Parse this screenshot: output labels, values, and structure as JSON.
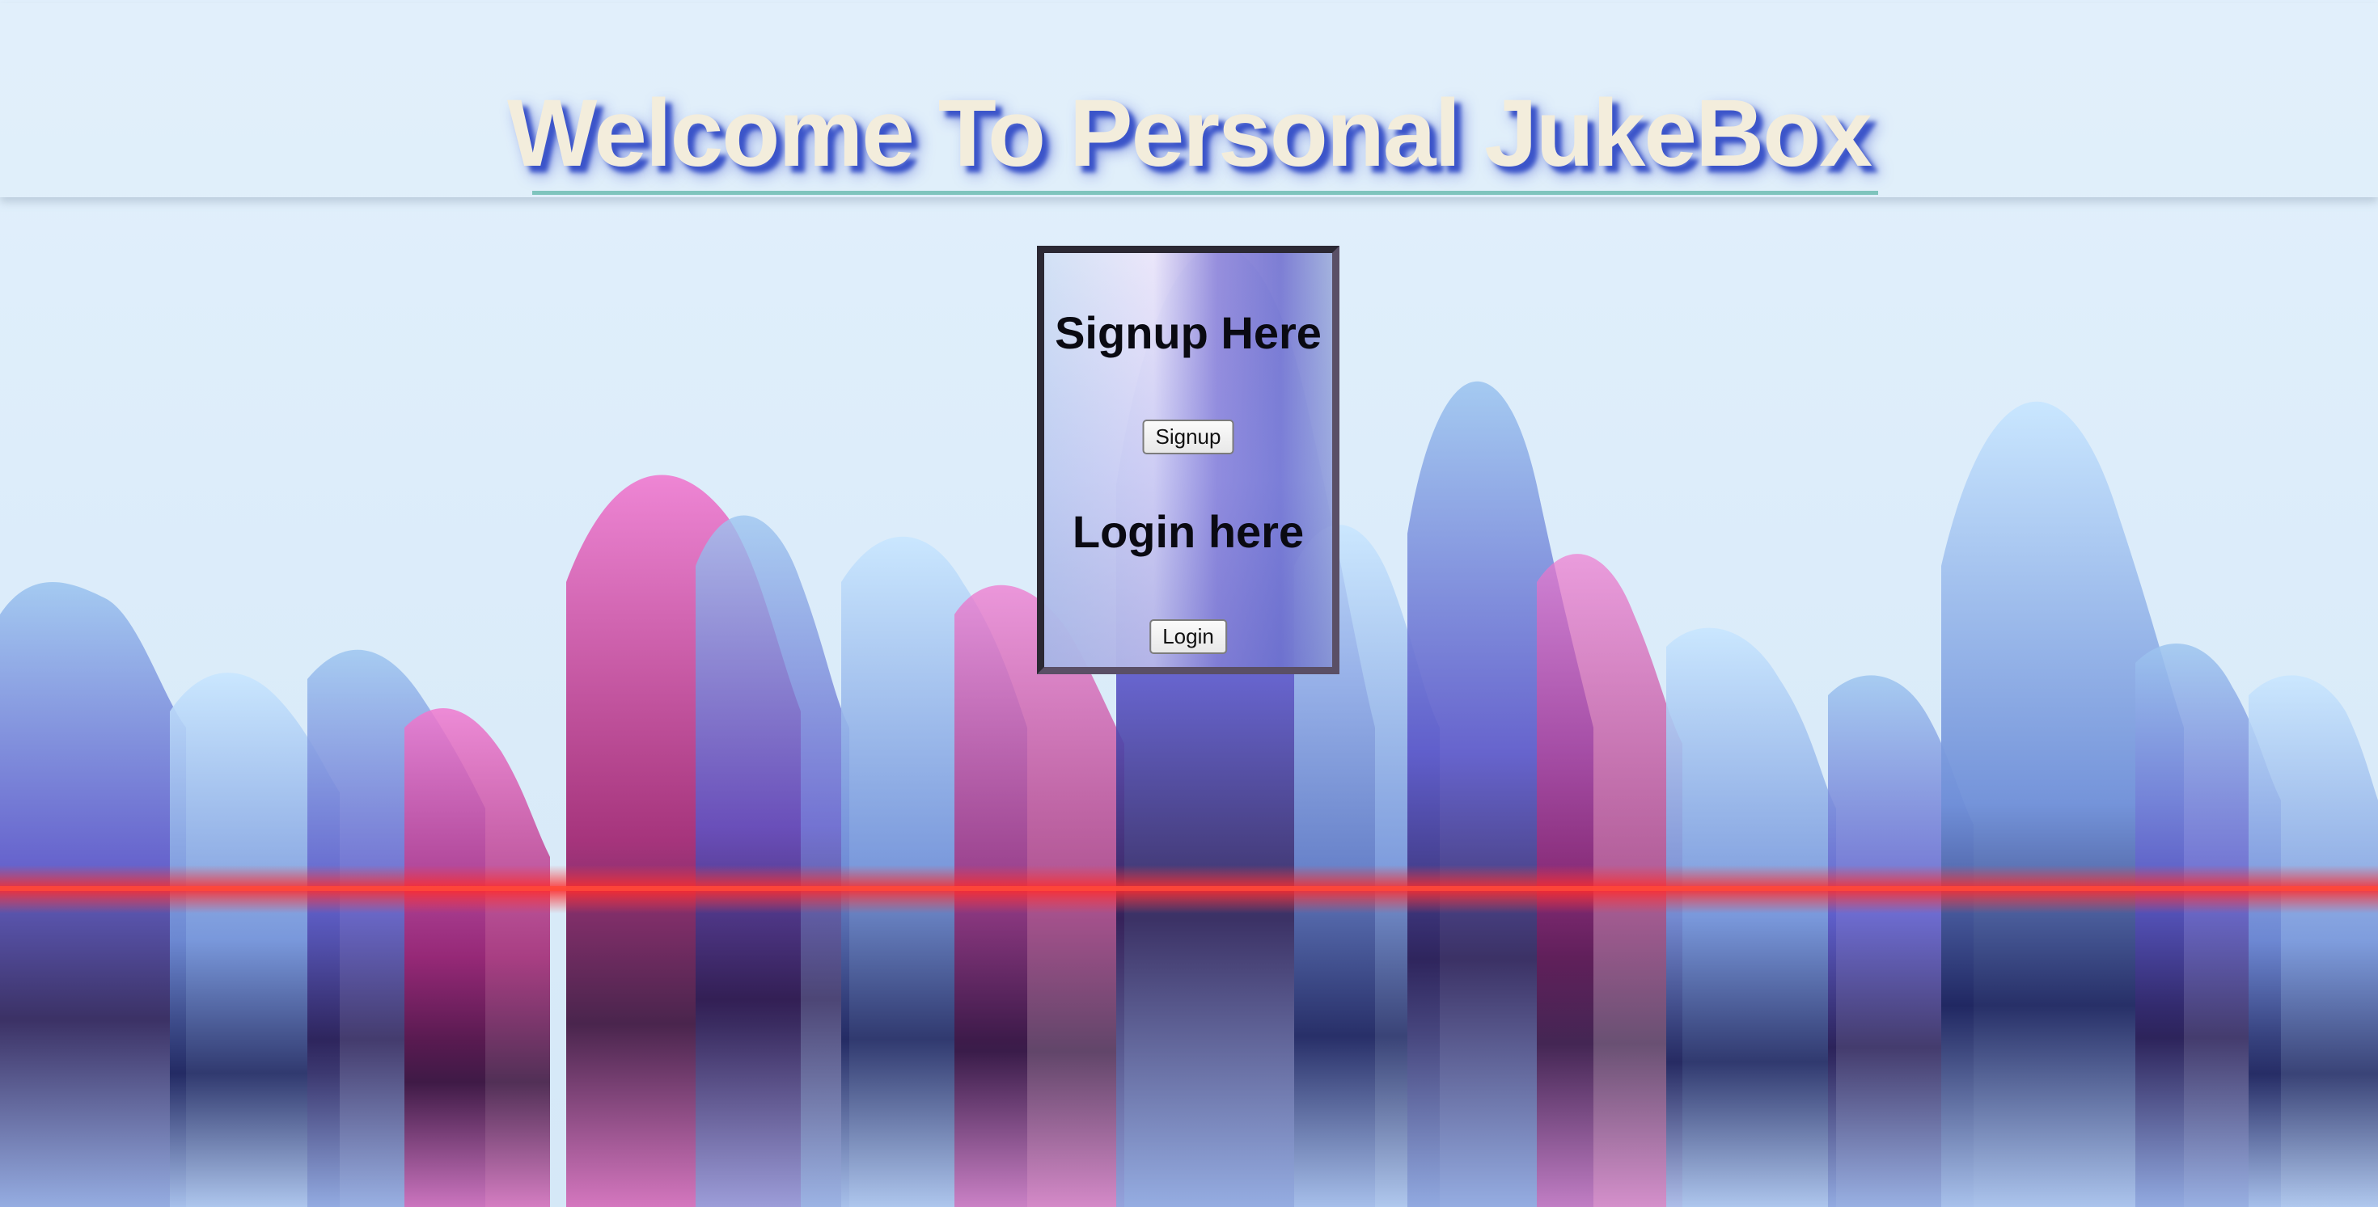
{
  "header": {
    "title": "Welcome To Personal JukeBox"
  },
  "auth_panel": {
    "signup_heading": "Signup Here",
    "signup_button": "Signup",
    "login_heading": "Login here",
    "login_button": "Login"
  },
  "colors": {
    "title_text": "#f3eddc",
    "title_shadow": "#3b54c9",
    "underline": "#7fc4bd",
    "panel_border": "#2b2833",
    "background": "#dceefb"
  }
}
